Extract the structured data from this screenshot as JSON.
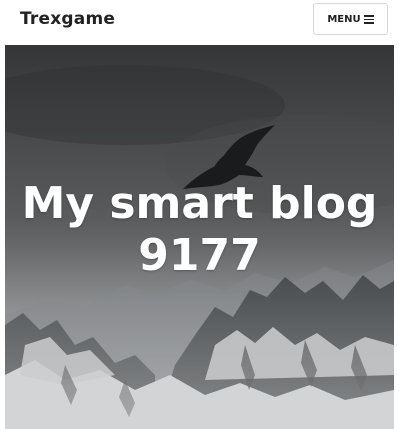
{
  "header": {
    "site_name": "Trexgame",
    "menu_label": "MENU"
  },
  "hero": {
    "title_line1": "My smart blog",
    "title_line2": "9177"
  },
  "icons": {
    "menu": "hamburger-icon",
    "hero_bird": "bird-silhouette"
  },
  "colors": {
    "header_bg": "#ffffff",
    "brand_text": "#222222",
    "hero_text": "#ffffff",
    "sky_top": "#3a3a3a",
    "sky_bottom": "#8e9092",
    "snow": "#e6e7e8"
  }
}
